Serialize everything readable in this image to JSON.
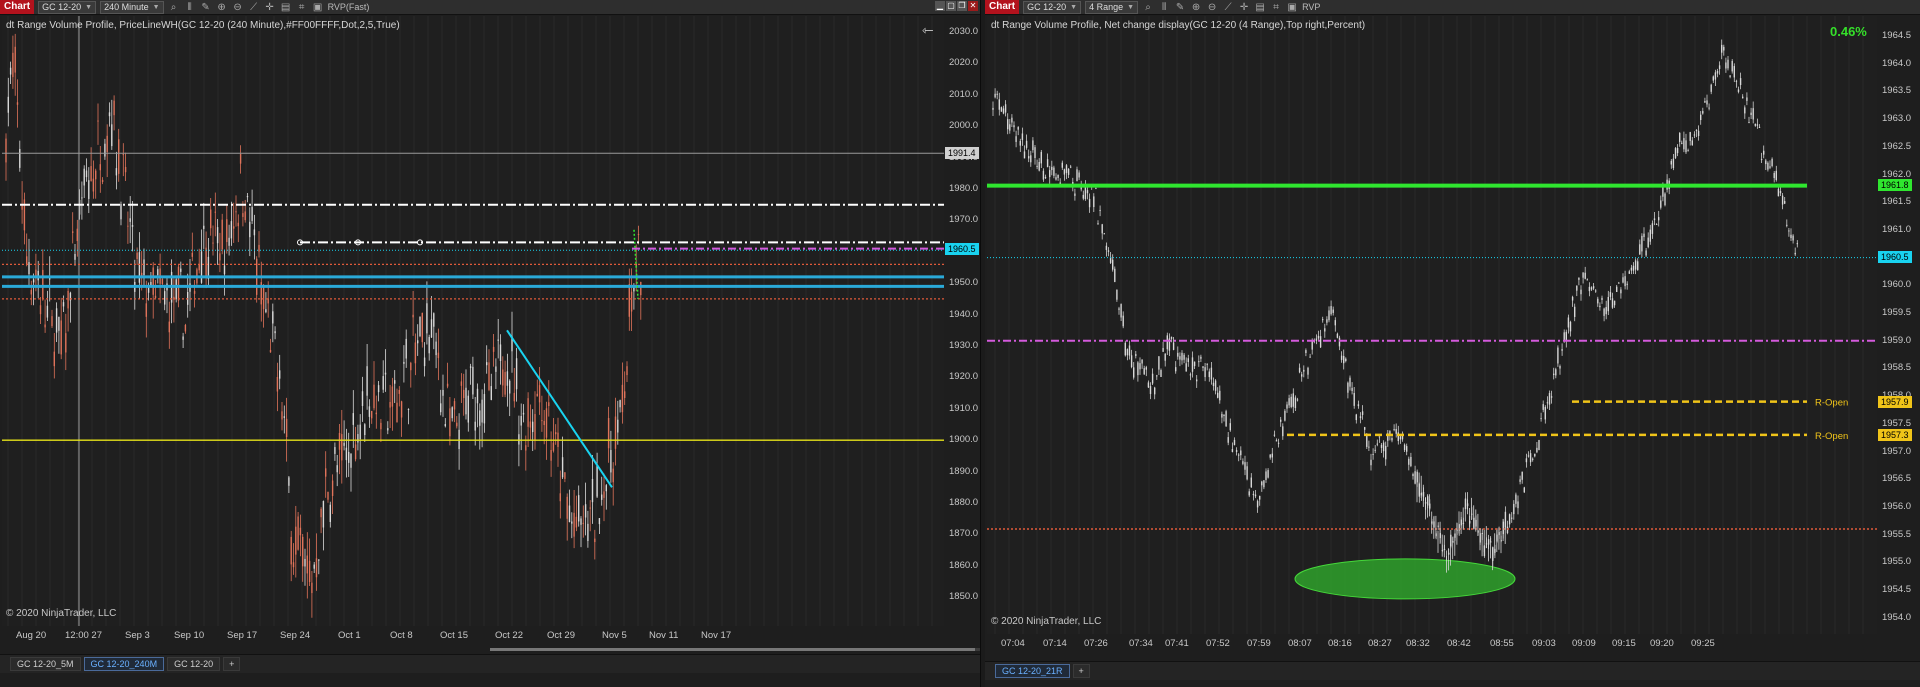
{
  "left": {
    "toolbar": {
      "chart_tag": "Chart",
      "instrument": "GC 12-20",
      "interval": "240 Minute",
      "indicator_button": "RVP(Fast)"
    },
    "indicator_label": "dt Range Volume Profile, PriceLineWH(GC 12-20 (240 Minute),#FF00FFFF,Dot,2,5,True)",
    "copyright": "© 2020 NinjaTrader, LLC",
    "price_ticks": [
      "2030.0",
      "2020.0",
      "2010.0",
      "2000.0",
      "1990.0",
      "1980.0",
      "1970.0",
      "1960.0",
      "1950.0",
      "1940.0",
      "1930.0",
      "1920.0",
      "1910.0",
      "1900.0",
      "1890.0",
      "1880.0",
      "1870.0",
      "1860.0",
      "1850.0"
    ],
    "time_ticks": [
      "Aug 20",
      "12:00 27",
      "Sep 3",
      "Sep 10",
      "Sep 17",
      "Sep 24",
      "Oct 1",
      "Oct 8",
      "Oct 15",
      "Oct 22",
      "Oct 29",
      "Nov 5",
      "Nov 11",
      "Nov 17"
    ],
    "crosshair_price": "1991.4",
    "last_price": "1960.5",
    "tabs": [
      "GC 12-20_5M",
      "GC 12-20_240M",
      "GC 12-20"
    ],
    "active_tab": 1,
    "colors": {
      "background": "#1f1f1f",
      "last_price": "#19d3f0",
      "trendline": "#19d3f0",
      "yellow_line": "#e6e21a"
    }
  },
  "right": {
    "toolbar": {
      "chart_tag": "Chart",
      "instrument": "GC 12-20",
      "interval": "4 Range",
      "indicator_button": "RVP"
    },
    "indicator_label": "dt Range Volume Profile, Net change display(GC 12-20 (4 Range),Top right,Percent)",
    "net_change": "0.46%",
    "copyright": "© 2020 NinjaTrader, LLC",
    "price_ticks": [
      "1964.5",
      "1964.0",
      "1963.5",
      "1963.0",
      "1962.5",
      "1962.0",
      "1961.5",
      "1961.0",
      "1960.5",
      "1960.0",
      "1959.5",
      "1959.0",
      "1958.5",
      "1958.0",
      "1957.5",
      "1957.0",
      "1956.5",
      "1956.0",
      "1955.5",
      "1955.0",
      "1954.5",
      "1954.0"
    ],
    "time_ticks": [
      "07:04",
      "07:14",
      "07:26",
      "07:34",
      "07:41",
      "07:52",
      "07:59",
      "08:07",
      "08:16",
      "08:27",
      "08:32",
      "08:42",
      "08:55",
      "09:03",
      "09:09",
      "09:15",
      "09:20",
      "09:25"
    ],
    "green_line_price": "1961.8",
    "last_price": "1960.5",
    "r_open_1_price": "1957.9",
    "r_open_2_price": "1957.3",
    "r_open_label": "R-Open",
    "tabs": [
      "GC 12-20_21R"
    ],
    "active_tab": 0,
    "colors": {
      "green_line": "#2fe62f",
      "last_price": "#19d3f0",
      "magenta_line": "#d45adc",
      "r_open": "#f0c419",
      "ellipse": "#2fa12b"
    }
  }
}
